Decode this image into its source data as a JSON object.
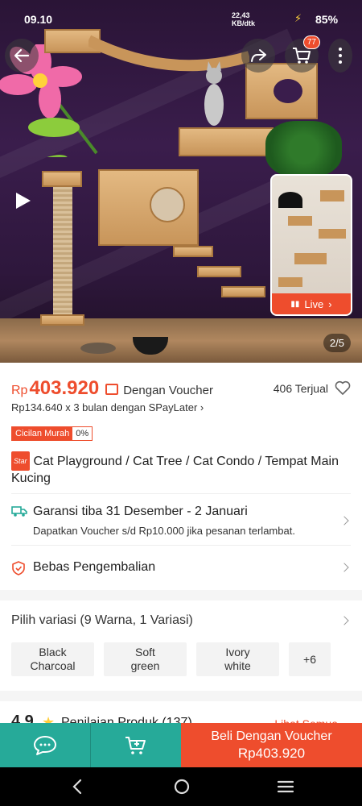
{
  "status_bar": {
    "time": "09.10",
    "net_speed": "22,43 KB/dtk",
    "battery": "85%"
  },
  "gallery": {
    "counter": "2/5",
    "live_label": "Live",
    "cart_count": "77"
  },
  "price": {
    "currency": "Rp",
    "amount": "403.920",
    "voucher_text": "Dengan Voucher",
    "sold": "406 Terjual",
    "installment": "Rp134.640 x 3 bulan dengan SPayLater"
  },
  "cicilan": {
    "label": "Cicilan Murah",
    "rate": "0%"
  },
  "product": {
    "badge": "Star",
    "title": "Cat Playground / Cat Tree / Cat Condo / Tempat Main Kucing"
  },
  "shipping": {
    "title": "Garansi tiba 31 Desember - 2 Januari",
    "subtitle": "Dapatkan Voucher s/d Rp10.000 jika pesanan terlambat."
  },
  "returns": {
    "title": "Bebas Pengembalian"
  },
  "variants": {
    "title": "Pilih variasi (9 Warna, 1 Variasi)",
    "options": [
      {
        "line1": "Black",
        "line2": "Charcoal"
      },
      {
        "line1": "Soft",
        "line2": "green"
      },
      {
        "line1": "Ivory",
        "line2": "white"
      }
    ],
    "more": "+6"
  },
  "rating": {
    "score": "4.9",
    "label": "Penilaian Produk (137)",
    "link": "Lihat Semua"
  },
  "bottom_bar": {
    "buy_label": "Beli Dengan Voucher",
    "buy_price": "Rp403.920"
  },
  "colors": {
    "accent": "#ee4d2d",
    "teal": "#26aa99",
    "star": "#ffce3d"
  }
}
